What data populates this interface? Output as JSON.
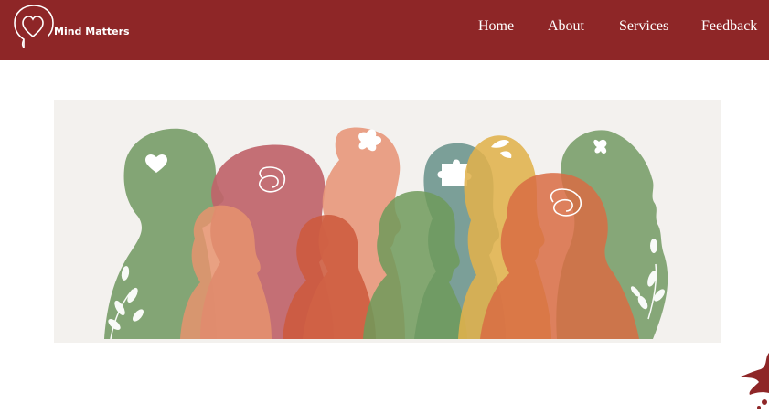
{
  "header": {
    "brand": "Mind Matters",
    "logo_icon": "head-heart-icon",
    "nav": [
      {
        "label": "Home"
      },
      {
        "label": "About"
      },
      {
        "label": "Services"
      },
      {
        "label": "Feedback"
      }
    ]
  },
  "hero": {
    "icon": "diverse-people-silhouettes-illustration"
  },
  "colors": {
    "navbar": "#8e2627",
    "nav_text": "#ffffff",
    "page_bg": "#ffffff",
    "hero_bg": "#f3f1ee",
    "green": "#7a9e6a",
    "rose": "#c0646a",
    "peach": "#e8977a",
    "teal": "#6e968e",
    "mustard": "#e0b24c",
    "orange": "#d86c43"
  }
}
